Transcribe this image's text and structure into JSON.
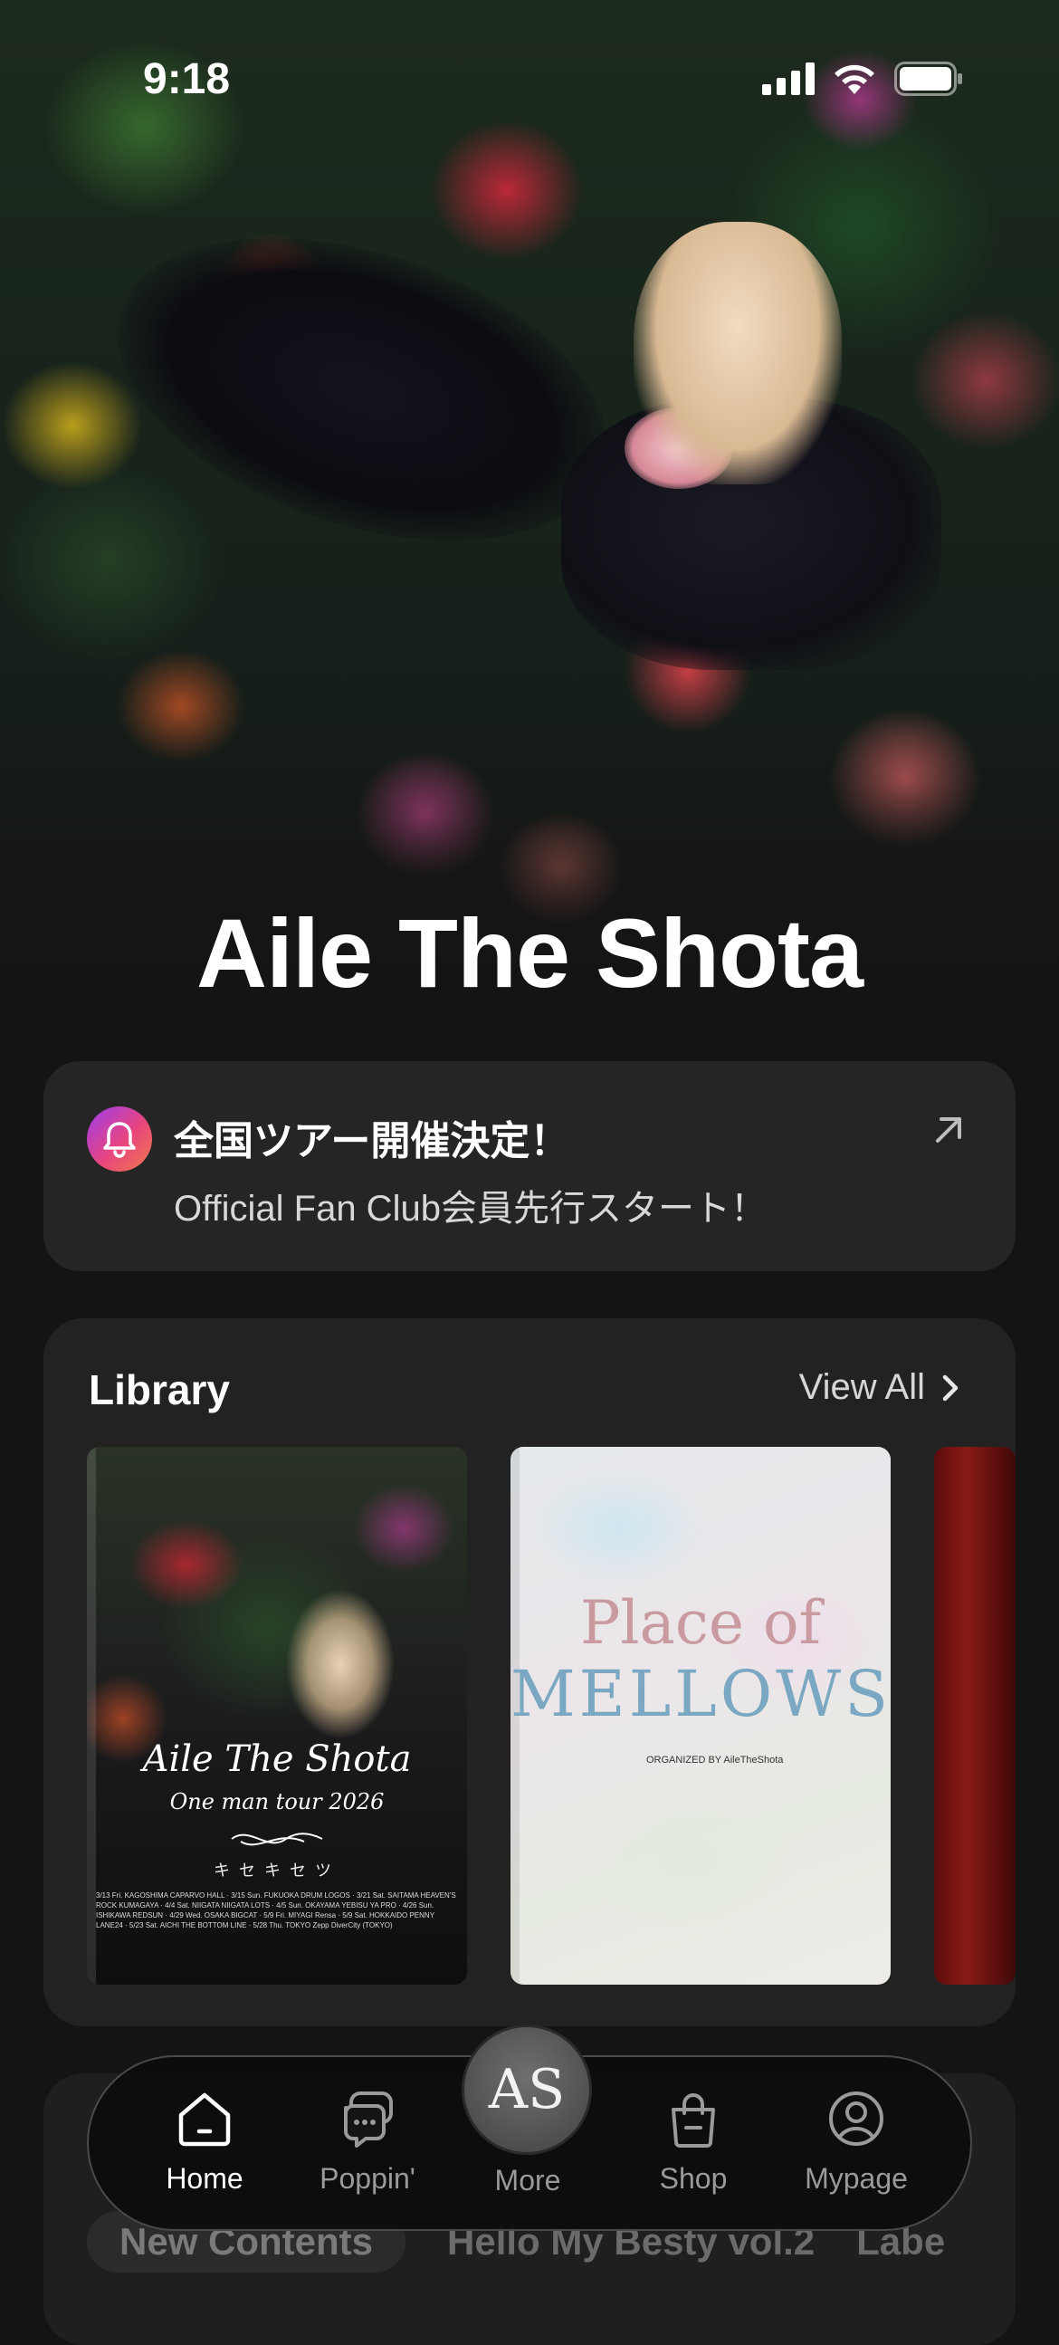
{
  "status_bar": {
    "time": "9:18"
  },
  "hero": {
    "artist_name": "Aile The Shota"
  },
  "announcement": {
    "title": "全国ツアー開催決定！",
    "subtitle": "Official Fan Club会員先行スタート！",
    "icon": "bell-icon",
    "accent_gradient": [
      "#9d3cf0",
      "#e8457d",
      "#f07a4a"
    ]
  },
  "library": {
    "title": "Library",
    "view_all": "View All",
    "items": [
      {
        "title": "Aile The Shota",
        "subtitle": "One man tour 2026",
        "japanese": "キセキセツ",
        "dates": "3/13 Fri. KAGOSHIMA CAPARVO HALL · 3/15 Sun. FUKUOKA DRUM LOGOS · 3/21 Sat. SAITAMA HEAVEN'S ROCK KUMAGAYA · 4/4 Sat. NIIGATA NIIGATA LOTS · 4/5 Sun. OKAYAMA YEBISU YA PRO · 4/26 Sun. ISHIKAWA REDSUN · 4/29 Wed. OSAKA BIGCAT · 5/9 Fri. MIYAGI Rensa · 5/9 Sat. HOKKAIDO PENNY LANE24 · 5/23 Sat. AICHI THE BOTTOM LINE · 5/28 Thu. TOKYO Zepp DiverCity (TOKYO)"
      },
      {
        "title": "Place of",
        "title_line2": "MELLOWS",
        "organizer": "ORGANIZED BY AileTheShota"
      },
      {
        "title": ""
      }
    ]
  },
  "content_chips": [
    "New Contents",
    "Hello My Besty vol.2",
    "Labe"
  ],
  "tab_bar": {
    "items": [
      {
        "label": "Home",
        "icon": "home-icon",
        "active": true
      },
      {
        "label": "Poppin'",
        "icon": "chat-bubbles-icon",
        "active": false
      },
      {
        "label": "More",
        "icon": "ats-logo-icon",
        "active": false
      },
      {
        "label": "Shop",
        "icon": "shopping-bag-icon",
        "active": false
      },
      {
        "label": "Mypage",
        "icon": "user-icon",
        "active": false
      }
    ],
    "logo_text": "AS"
  }
}
